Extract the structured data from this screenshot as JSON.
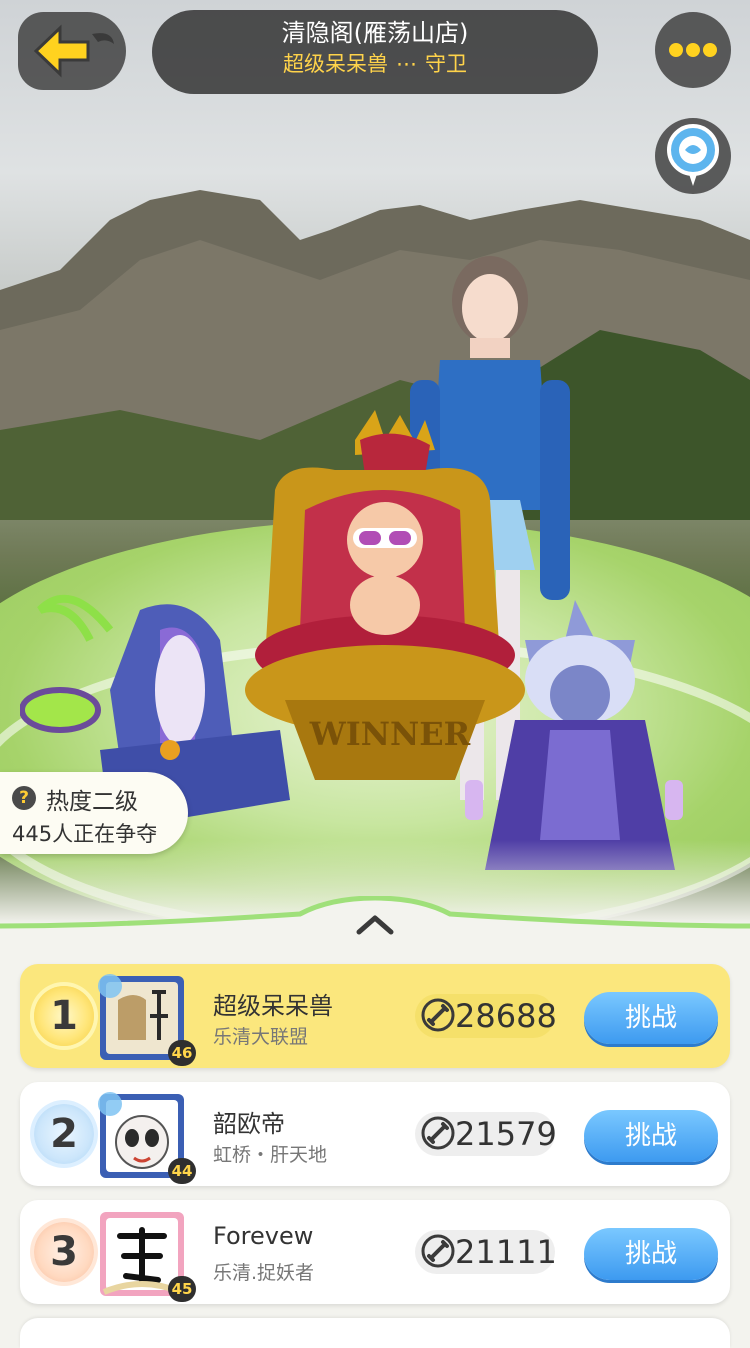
{
  "header": {
    "title": "清隐阁(雁荡山店)",
    "guard_name": "超级呆呆兽",
    "guard_suffix": "守卫"
  },
  "heat": {
    "level": "热度二级",
    "count": "445人正在争夺",
    "help_glyph": "?"
  },
  "throne_text": "WINNER",
  "ranking": [
    {
      "rank": "1",
      "name": "超级呆呆兽",
      "team": "乐清大联盟",
      "score": "28688",
      "level": "46",
      "action": "挑战"
    },
    {
      "rank": "2",
      "name": "韶欧帝",
      "team": "虹桥・肝天地",
      "score": "21579",
      "level": "44",
      "action": "挑战"
    },
    {
      "rank": "3",
      "name": "Forevew",
      "team": "乐清.捉妖者",
      "score": "21111",
      "level": "45",
      "action": "挑战"
    }
  ],
  "icons": {
    "back": "back-arrow-icon",
    "more": "more-dots-icon",
    "location": "location-pin-icon",
    "expand": "chevron-up-icon",
    "score": "sword-badge-icon"
  },
  "colors": {
    "accent_yellow": "#ffd34a",
    "first_row_bg": "#fbe77d",
    "challenge_blue": "#3d9af0"
  }
}
